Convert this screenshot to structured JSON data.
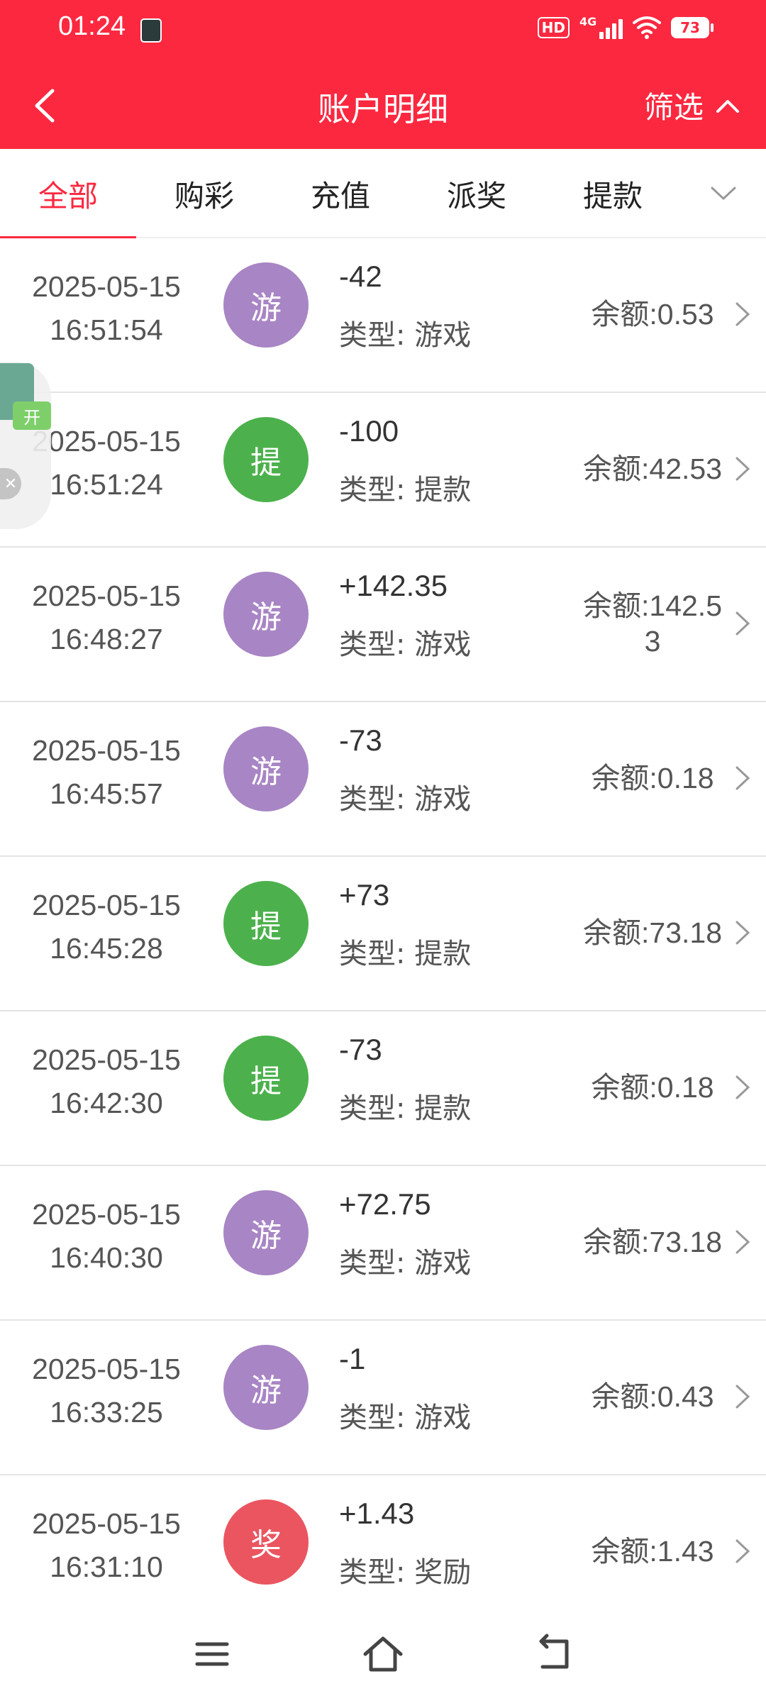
{
  "status_bar": {
    "time": "01:24",
    "hd": "HD",
    "network": "4G",
    "battery": "73"
  },
  "header": {
    "title": "账户明细",
    "filter_label": "筛选"
  },
  "tabs": [
    {
      "label": "全部",
      "active": true
    },
    {
      "label": "购彩",
      "active": false
    },
    {
      "label": "充值",
      "active": false
    },
    {
      "label": "派奖",
      "active": false
    },
    {
      "label": "提款",
      "active": false
    }
  ],
  "floating_widget": {
    "open_label": "开"
  },
  "records": [
    {
      "date": "2025-05-15",
      "time": "16:51:54",
      "badge": "游",
      "badge_color": "#a885c4",
      "amount": "-42",
      "type": "类型: 游戏",
      "balance": "余额:0.53"
    },
    {
      "date": "2025-05-15",
      "time": "16:51:24",
      "badge": "提",
      "badge_color": "#4cb14c",
      "amount": "-100",
      "type": "类型: 提款",
      "balance": "余额:42.53"
    },
    {
      "date": "2025-05-15",
      "time": "16:48:27",
      "badge": "游",
      "badge_color": "#a885c4",
      "amount": "+142.35",
      "type": "类型: 游戏",
      "balance": "余额:142.53"
    },
    {
      "date": "2025-05-15",
      "time": "16:45:57",
      "badge": "游",
      "badge_color": "#a885c4",
      "amount": "-73",
      "type": "类型: 游戏",
      "balance": "余额:0.18"
    },
    {
      "date": "2025-05-15",
      "time": "16:45:28",
      "badge": "提",
      "badge_color": "#4cb14c",
      "amount": "+73",
      "type": "类型: 提款",
      "balance": "余额:73.18"
    },
    {
      "date": "2025-05-15",
      "time": "16:42:30",
      "badge": "提",
      "badge_color": "#4cb14c",
      "amount": "-73",
      "type": "类型: 提款",
      "balance": "余额:0.18"
    },
    {
      "date": "2025-05-15",
      "time": "16:40:30",
      "badge": "游",
      "badge_color": "#a885c4",
      "amount": "+72.75",
      "type": "类型: 游戏",
      "balance": "余额:73.18"
    },
    {
      "date": "2025-05-15",
      "time": "16:33:25",
      "badge": "游",
      "badge_color": "#a885c4",
      "amount": "-1",
      "type": "类型: 游戏",
      "balance": "余额:0.43"
    },
    {
      "date": "2025-05-15",
      "time": "16:31:10",
      "badge": "奖",
      "badge_color": "#ea5560",
      "amount": "+1.43",
      "type": "类型: 奖励",
      "balance": "余额:1.43"
    }
  ],
  "colors": {
    "accent": "#fb2840",
    "game_badge": "#a885c4",
    "withdraw_badge": "#4cb14c",
    "reward_badge": "#ea5560"
  }
}
